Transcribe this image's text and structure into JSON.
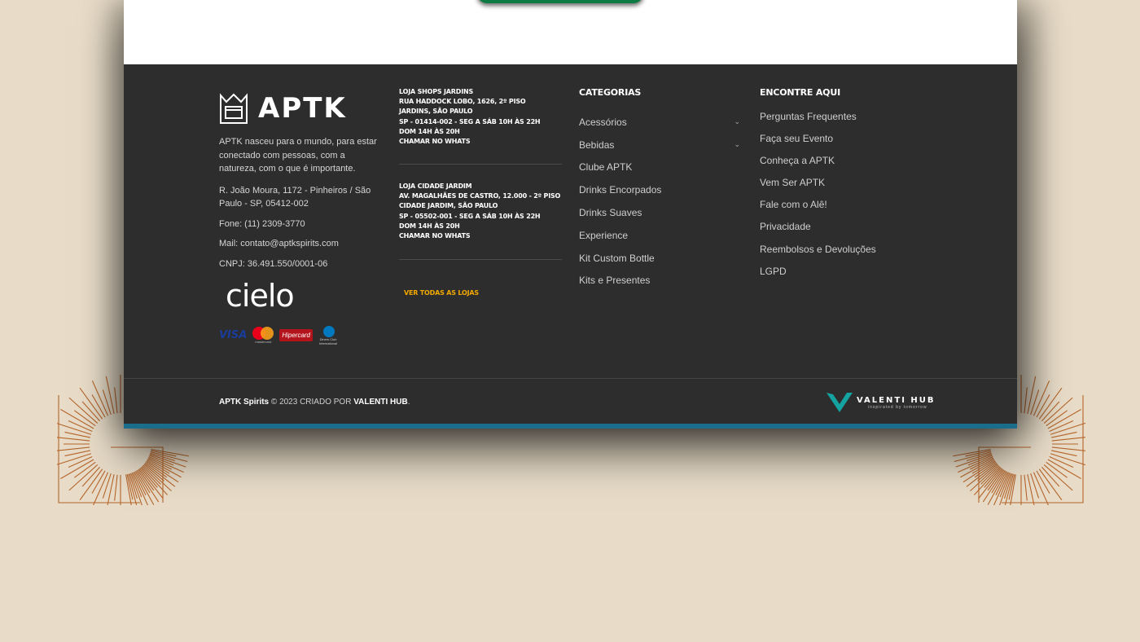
{
  "brand": {
    "name": "APTK"
  },
  "about": {
    "description": "APTK nasceu para o mundo, para estar conectado com pessoas, com a natureza, com o que é importante.",
    "address": "R. João Moura, 1172 - Pinheiros / São Paulo - SP, 05412-002",
    "phone": "Fone: (11) 2309-3770",
    "mail": "Mail: contato@aptkspirits.com",
    "cnpj": "CNPJ: 36.491.550/0001-06"
  },
  "payment": {
    "cielo": "cielo",
    "cards": {
      "visa": "VISA",
      "mastercard": "mastercard",
      "hipercard": "Hipercard",
      "diners": "Diners Club International"
    }
  },
  "stores": [
    {
      "name": "Loja Shops Jardins",
      "lines": [
        "Rua Haddock Lobo, 1626, 2º piso",
        "Jardins, São Paulo",
        "SP - 01414-002 - Seg a Sáb 10h às 22h",
        "Dom 14h às 20h",
        "Chamar no whats"
      ]
    },
    {
      "name": "Loja Cidade Jardim",
      "lines": [
        "Av. Magalhães de Castro, 12.000 - 2º piso",
        "Cidade Jardim, São Paulo",
        "SP - 05502-001 - Seg a Sáb 10h às 22h",
        "Dom 14h às 20h",
        "Chamar no whats"
      ]
    }
  ],
  "all_stores_label": "Ver todas as lojas",
  "categories": {
    "title": "Categorias",
    "items": [
      "Acessórios",
      "Bebidas",
      "Clube APTK",
      "Drinks Encorpados",
      "Drinks Suaves",
      "Experience",
      "Kit Custom Bottle",
      "Kits e Presentes"
    ]
  },
  "find_here": {
    "title": "Encontre Aqui",
    "items": [
      "Perguntas Frequentes",
      "Faça seu Evento",
      "Conheça a APTK",
      "Vem Ser APTK",
      "Fale com o Alê!",
      "Privacidade",
      "Reembolsos e Devoluções",
      "LGPD"
    ]
  },
  "copyright": {
    "brand": "APTK Spirits",
    "text": "2023 CRIADO POR",
    "agency": "VALENTI HUB",
    "end": "."
  },
  "valenti": {
    "name": "VALENTI HUB",
    "tagline": "inspirated by tomorrow"
  },
  "colors": {
    "background": "#e8dcc8",
    "footer": "#2d2d2d",
    "accent_bar": "#1a6e8c",
    "link_accent": "#f2a900",
    "sunburst": "#b5652a",
    "valenti_teal": "#14a3a0"
  }
}
